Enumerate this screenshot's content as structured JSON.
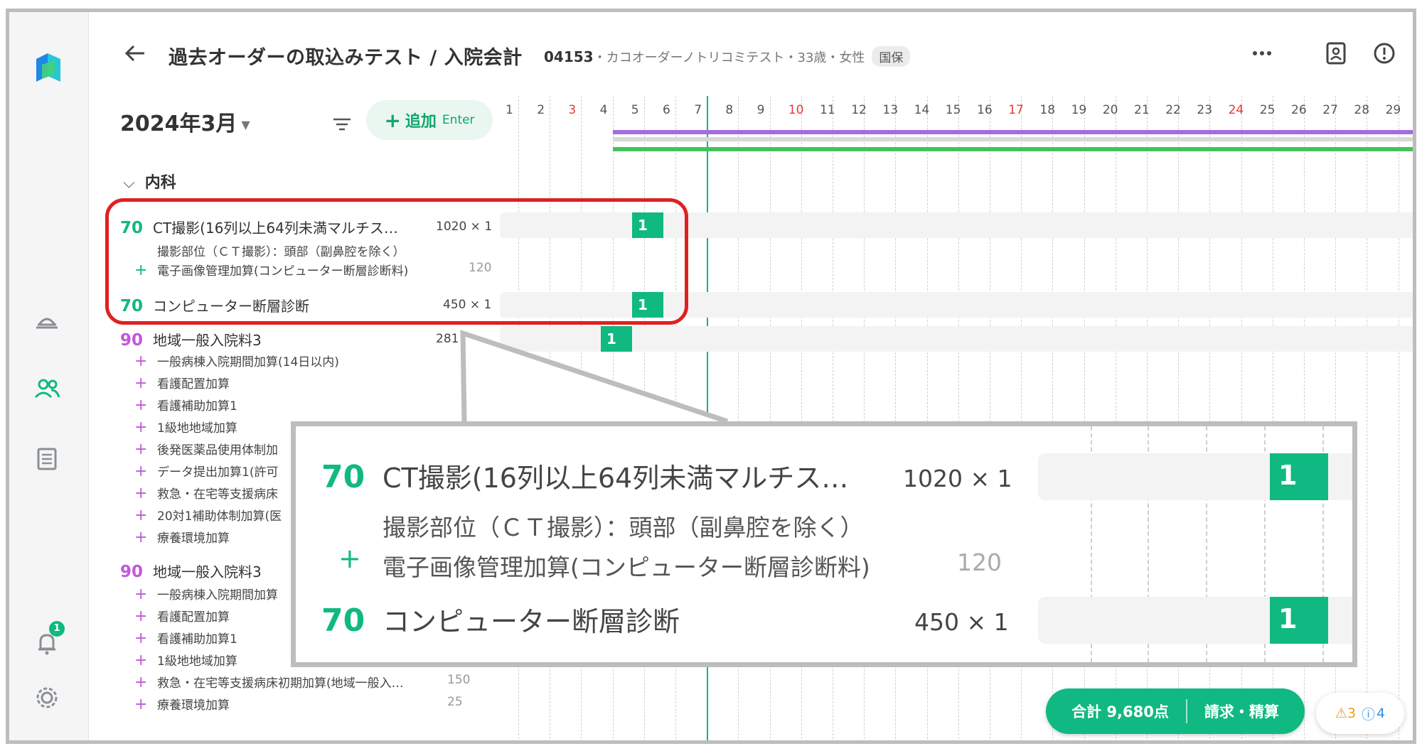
{
  "header": {
    "title": "過去オーダーの取込みテスト / 入院会計",
    "patient_id": "04153",
    "patient_detail": "・カコオーダーノトリコミテスト・33歳・女性",
    "insurance": "国保"
  },
  "toolbar": {
    "month": "2024年3月",
    "add_label": "追加",
    "add_hint": "Enter"
  },
  "calendar": {
    "days": [
      "1",
      "2",
      "3",
      "4",
      "5",
      "6",
      "7",
      "8",
      "9",
      "10",
      "11",
      "12",
      "13",
      "14",
      "15",
      "16",
      "17",
      "18",
      "19",
      "20",
      "21",
      "22",
      "23",
      "24",
      "25",
      "26",
      "27",
      "28",
      "29"
    ],
    "red_days": [
      "3",
      "10",
      "17",
      "24"
    ],
    "today": "7"
  },
  "section": {
    "label": "内科"
  },
  "orders": [
    {
      "points": "70",
      "name": "CT撮影(16列以上64列未満マルチス…",
      "qty": "1020 × 1",
      "detail": "撮影部位（ＣＴ撮影）：頭部（副鼻腔を除く）",
      "addon": "電子画像管理加算(コンピューター断層診断料)",
      "addon_points": "120",
      "chip": "1"
    },
    {
      "points": "70",
      "name": "コンピューター断層診断",
      "qty": "450 × 1",
      "chip": "1"
    },
    {
      "points": "90",
      "name": "地域一般入院料3",
      "qty": "281",
      "chip": "1",
      "addons": [
        "一般病棟入院期間加算(14日以内)",
        "看護配置加算",
        "看護補助加算1",
        "1級地地域加算",
        "後発医薬品使用体制加",
        "データ提出加算1(許可",
        "救急・在宅等支援病床",
        "20対1補助体制加算(医",
        "療養環境加算"
      ]
    },
    {
      "points": "90",
      "name": "地域一般入院料3",
      "addons": [
        "一般病棟入院期間加算",
        "看護配置加算",
        "看護補助加算1",
        "1級地地域加算",
        "救急・在宅等支援病床初期加算(地域一般入…",
        "療養環境加算"
      ],
      "addon_points": [
        "",
        "",
        "",
        "",
        "150",
        "25"
      ]
    }
  ],
  "zoom": {
    "row1": {
      "points": "70",
      "name": "CT撮影(16列以上64列未満マルチス…",
      "qty": "1020 × 1",
      "chip": "1"
    },
    "detail": "撮影部位（ＣＴ撮影）：頭部（副鼻腔を除く）",
    "addon": "電子画像管理加算(コンピューター断層診断料)",
    "addon_points": "120",
    "row2": {
      "points": "70",
      "name": "コンピューター断層診断",
      "qty": "450 × 1",
      "chip": "1"
    }
  },
  "footer": {
    "total": "合計 9,680点",
    "bill": "請求・精算",
    "warnings": "3",
    "infos": "4"
  },
  "nav": {
    "notification_count": "1"
  },
  "colors": {
    "accent": "#10b981",
    "purple": "#c158dc",
    "highlight": "#e02020"
  }
}
